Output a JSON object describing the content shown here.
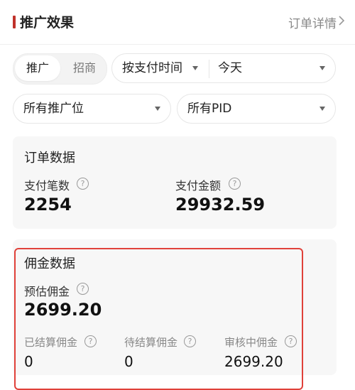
{
  "header": {
    "title": "推广效果",
    "link": "订单详情",
    "accent_color": "#c0322b"
  },
  "filters": {
    "segment": {
      "active": "推广",
      "inactive": "招商"
    },
    "pay_time": {
      "label": "按支付时间"
    },
    "date": {
      "label": "今天"
    },
    "position": {
      "label": "所有推广位"
    },
    "pid": {
      "label": "所有PID"
    }
  },
  "order_card": {
    "title": "订单数据",
    "metrics": [
      {
        "label": "支付笔数",
        "value": "2254"
      },
      {
        "label": "支付金额",
        "value": "29932.59"
      }
    ]
  },
  "commission_card": {
    "title": "佣金数据",
    "main": {
      "label": "预估佣金",
      "value": "2699.20"
    },
    "subs": [
      {
        "label": "已结算佣金",
        "value": "0"
      },
      {
        "label": "待结算佣金",
        "value": "0"
      },
      {
        "label": "审核中佣金",
        "value": "2699.20"
      }
    ],
    "highlight_color": "#e0413a"
  },
  "icons": {
    "help": "?"
  }
}
